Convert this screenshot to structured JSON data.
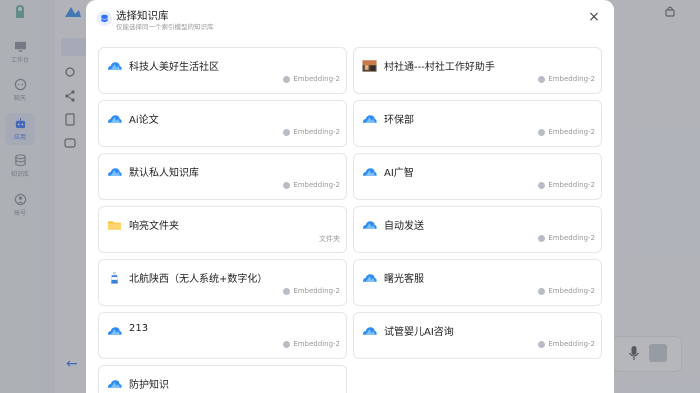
{
  "sidebar": {
    "items": [
      {
        "label": "工作台",
        "icon": "monitor-icon"
      },
      {
        "label": "聊天",
        "icon": "chat-icon"
      },
      {
        "label": "应用",
        "icon": "robot-icon",
        "active": true
      },
      {
        "label": "知识库",
        "icon": "database-icon"
      },
      {
        "label": "账号",
        "icon": "user-icon"
      }
    ]
  },
  "modal": {
    "title": "选择知识库",
    "subtitle": "仅能选择同一个索引模型的知识库",
    "close_label": "×"
  },
  "knowledge_bases": [
    {
      "name": "科技人美好生活社区",
      "meta": "Embedding-2",
      "icon": "cloud-icon"
    },
    {
      "name": "村社通---村社工作好助手",
      "meta": "Embedding-2",
      "icon": "thumbnail-image"
    },
    {
      "name": "Ai论文",
      "meta": "Embedding-2",
      "icon": "cloud-icon"
    },
    {
      "name": "环保部",
      "meta": "Embedding-2",
      "icon": "cloud-icon"
    },
    {
      "name": "默认私人知识库",
      "meta": "Embedding-2",
      "icon": "cloud-icon"
    },
    {
      "name": "AI广智",
      "meta": "Embedding-2",
      "icon": "cloud-icon"
    },
    {
      "name": "响亮文件夹",
      "meta": "文件夹",
      "icon": "folder-icon"
    },
    {
      "name": "自动发送",
      "meta": "Embedding-2",
      "icon": "cloud-icon"
    },
    {
      "name": "北航陕西（无人系统+数字化）",
      "meta": "Embedding-2",
      "icon": "bottle-icon"
    },
    {
      "name": "曙光客服",
      "meta": "Embedding-2",
      "icon": "cloud-icon"
    },
    {
      "name": "213",
      "meta": "Embedding-2",
      "icon": "cloud-icon"
    },
    {
      "name": "试管婴儿AI咨询",
      "meta": "Embedding-2",
      "icon": "cloud-icon"
    },
    {
      "name": "防护知识",
      "meta": "",
      "icon": "cloud-icon"
    }
  ],
  "colors": {
    "accent": "#3370ff",
    "cloud": "#2f8cf4",
    "folder": "#ffc64a"
  }
}
